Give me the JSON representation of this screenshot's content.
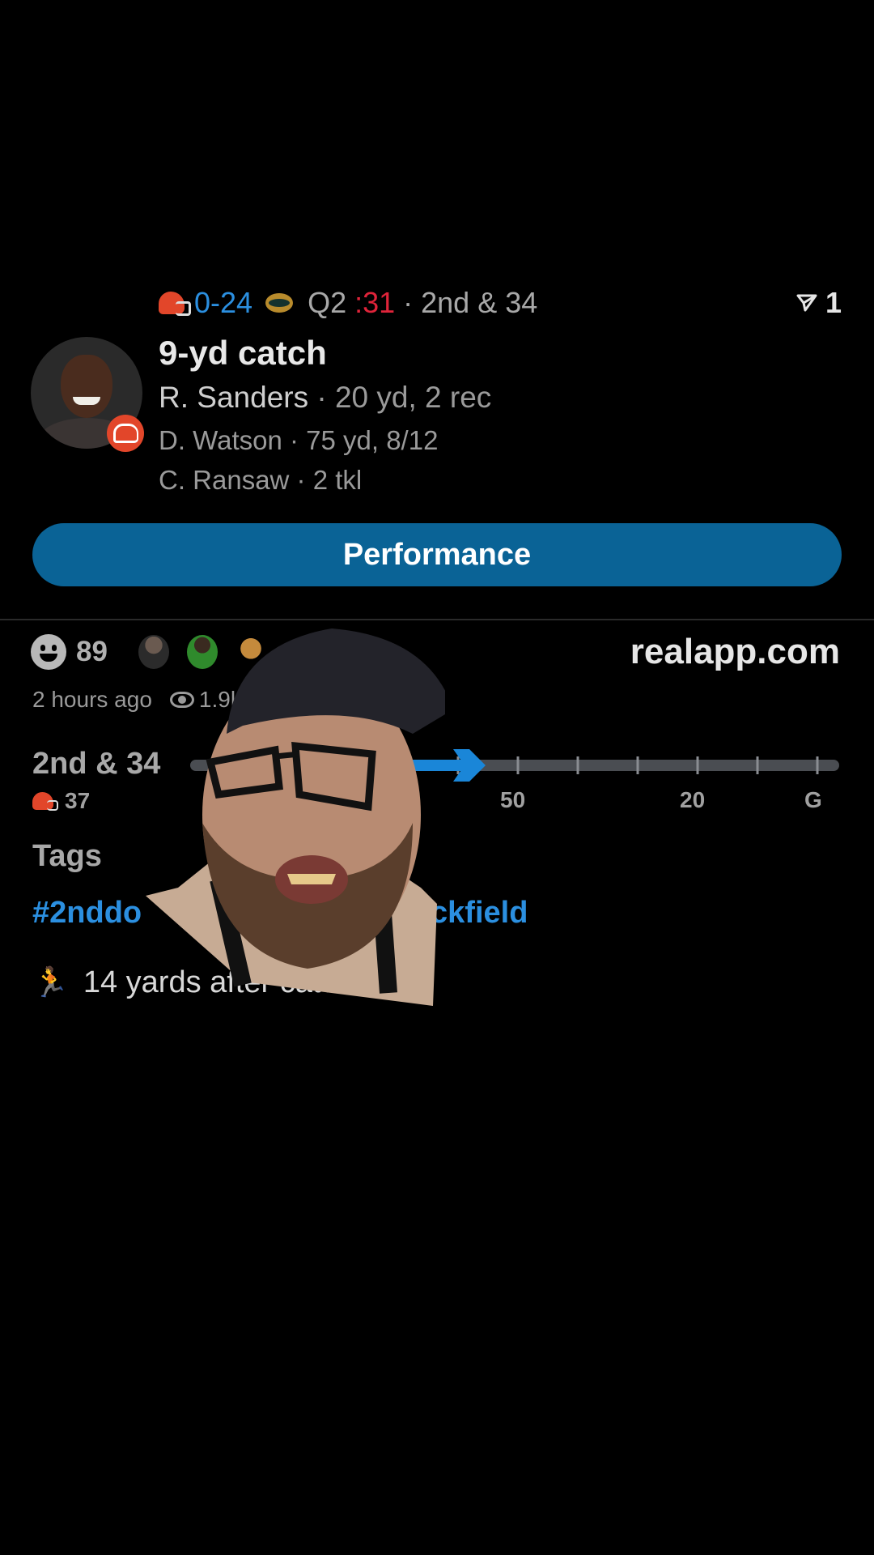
{
  "score": {
    "score_text": "0-24",
    "quarter": "Q2",
    "clock": ":31",
    "situation": "· 2nd & 34",
    "share_count": "1",
    "colors": {
      "score": "#2b8fe0",
      "clock": "#e0243a"
    }
  },
  "play": {
    "title": "9-yd catch",
    "player_name": "R. Sanders",
    "player_stats": "· 20 yd, 2 rec",
    "passer_line": "D. Watson · 75 yd, 8/12",
    "defender_line": "C. Ransaw · 2 tkl"
  },
  "performance_button": {
    "label": "Performance",
    "color": "#0a6396"
  },
  "reactions": {
    "count": "89"
  },
  "site": "realapp.com",
  "meta": {
    "time_ago": "2 hours ago",
    "views": "1.9k"
  },
  "drive": {
    "down_label": "2nd & 34",
    "start_yard": "37",
    "yard_labels": [
      "G",
      "50",
      "20",
      "G"
    ],
    "arrow_color": "#1a86d8"
  },
  "tags": {
    "heading": "Tags",
    "tag_left": "#2nddo",
    "tag_right": "backfield"
  },
  "summary": {
    "icon": "runner-icon",
    "text": "14 yards after catch"
  }
}
